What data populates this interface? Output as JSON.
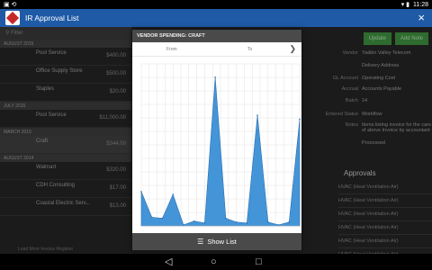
{
  "status_bar": {
    "left_icons": "▣ ⟲",
    "time": "11:28",
    "right_icons": "▾ ▮"
  },
  "app": {
    "title": "IR Approval List",
    "close_icon": "×"
  },
  "filter": {
    "placeholder": "Filter"
  },
  "left_list": {
    "sections": [
      {
        "label": "AUGUST 2015",
        "rows": [
          {
            "n": "",
            "vendor": "Pool Service",
            "date": "",
            "amount": "$400.00"
          },
          {
            "n": "",
            "vendor": "Office Supply Store",
            "date": "",
            "amount": "$500.00"
          },
          {
            "n": "",
            "vendor": "Staples",
            "date": "",
            "amount": "$20.00"
          }
        ]
      },
      {
        "label": "JULY 2015",
        "rows": [
          {
            "n": "",
            "vendor": "Pool Service",
            "date": "",
            "amount": "$11,000.00"
          }
        ]
      },
      {
        "label": "MARCH 2015",
        "rows": [
          {
            "n": "",
            "vendor": "Craft",
            "date": "",
            "amount": "$344.00"
          }
        ]
      },
      {
        "label": "AUGUST 2014",
        "rows": [
          {
            "n": "",
            "vendor": "Walmart",
            "date": "",
            "amount": "$320.00"
          },
          {
            "n": "",
            "vendor": "CDH Consulting",
            "date": "",
            "amount": "$17.00"
          },
          {
            "n": "",
            "vendor": "Coastal Electric Serv...",
            "date": "",
            "amount": "$13.00"
          }
        ]
      }
    ],
    "footer": "Load More Invoice Register"
  },
  "right_panel": {
    "buttons": [
      "Update",
      "Add Note"
    ],
    "fields": [
      {
        "k": "Vendor",
        "v": "Yadkin Valley Telecom"
      },
      {
        "k": "",
        "v": "Delivery Address"
      },
      {
        "k": "GL Account",
        "v": "Operating Cost"
      },
      {
        "k": "Accrual",
        "v": "Accounts Payable"
      },
      {
        "k": "Batch",
        "v": "14"
      },
      {
        "k": "Entered Status",
        "v": "Workflow"
      },
      {
        "k": "Notes",
        "v": "Items listing invoice for the care of above Invoice by accountant"
      },
      {
        "k": "",
        "v": "Processed"
      }
    ],
    "approvals_title": "Approvals",
    "approvals": [
      "HVAC (Heat Ventilation Air)",
      "HVAC (Heat Ventilation Air)",
      "HVAC (Heat Ventilation Air)",
      "HVAC (Heat Ventilation Air)",
      "HVAC (Heat Ventilation Air)",
      "HVAC (Heat Ventilation Air)"
    ]
  },
  "modal": {
    "title": "VENDOR SPENDING: CRAFT",
    "from_label": "From",
    "to_label": "To",
    "next_icon": "❯",
    "footer_icon": "☰",
    "footer_label": "Show List"
  },
  "chart_data": {
    "type": "area",
    "color": "#3a8fd6",
    "values": [
      180,
      45,
      40,
      165,
      5,
      25,
      15,
      780,
      40,
      20,
      15,
      580,
      20,
      5,
      20,
      560
    ],
    "ylim": [
      0,
      850
    ]
  },
  "nav": {
    "back": "◁",
    "home": "○",
    "recent": "□"
  }
}
